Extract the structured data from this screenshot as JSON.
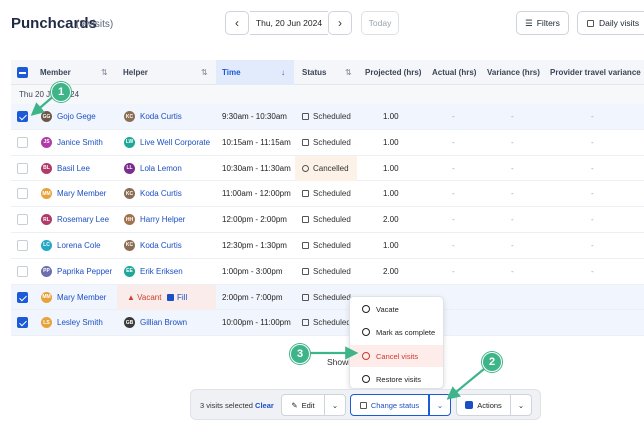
{
  "header": {
    "title": "Punchcards",
    "count": "(9 visits)",
    "date": "Thu, 20 Jun 2024",
    "today": "Today",
    "filters": "Filters",
    "view": "Daily visits"
  },
  "table": {
    "columns": [
      "Member",
      "Helper",
      "Time",
      "Status",
      "Projected (hrs)",
      "Actual (hrs)",
      "Variance (hrs)",
      "Provider travel variance"
    ],
    "group": "Thu 20 Jun 2024",
    "rows": [
      {
        "member": "Gojo Gege",
        "initials": "GG",
        "member_color": "#6b5847",
        "helper": "Koda Curtis",
        "helper_initials": "KC",
        "helper_color": "#8a6d54",
        "time": "9:30am - 10:30am",
        "status": "Scheduled",
        "projected": "1.00",
        "actual": "-",
        "variance": "-",
        "travel": "-",
        "selected": true
      },
      {
        "member": "Janice Smith",
        "initials": "JS",
        "member_color": "#b23aa6",
        "helper": "Live Well Corporate",
        "helper_initials": "LW",
        "helper_color": "#1fa89a",
        "time": "10:15am - 11:15am",
        "status": "Scheduled",
        "projected": "1.00",
        "actual": "-",
        "variance": "-",
        "travel": "-",
        "selected": false
      },
      {
        "member": "Basil Lee",
        "initials": "BL",
        "member_color": "#b23a6a",
        "helper": "Lola Lemon",
        "helper_initials": "LL",
        "helper_color": "#7b2c8c",
        "time": "10:30am - 11:30am",
        "status": "Cancelled",
        "projected": "1.00",
        "actual": "-",
        "variance": "-",
        "travel": "-",
        "selected": false
      },
      {
        "member": "Mary Member",
        "initials": "MM",
        "member_color": "#e8a23c",
        "helper": "Koda Curtis",
        "helper_initials": "KC",
        "helper_color": "#8a6d54",
        "time": "11:00am - 12:00pm",
        "status": "Scheduled",
        "projected": "1.00",
        "actual": "-",
        "variance": "-",
        "travel": "-",
        "selected": false
      },
      {
        "member": "Rosemary Lee",
        "initials": "RL",
        "member_color": "#b23a6a",
        "helper": "Harry Helper",
        "helper_initials": "HH",
        "helper_color": "#a0724e",
        "time": "12:00pm - 2:00pm",
        "status": "Scheduled",
        "projected": "2.00",
        "actual": "-",
        "variance": "-",
        "travel": "-",
        "selected": false
      },
      {
        "member": "Lorena Cole",
        "initials": "LC",
        "member_color": "#24a8c4",
        "helper": "Koda Curtis",
        "helper_initials": "KC",
        "helper_color": "#8a6d54",
        "time": "12:30pm - 1:30pm",
        "status": "Scheduled",
        "projected": "1.00",
        "actual": "-",
        "variance": "-",
        "travel": "-",
        "selected": false
      },
      {
        "member": "Paprika Pepper",
        "initials": "PP",
        "member_color": "#6c6fae",
        "helper": "Erik Eriksen",
        "helper_initials": "EE",
        "helper_color": "#1fa89a",
        "time": "1:00pm - 3:00pm",
        "status": "Scheduled",
        "projected": "2.00",
        "actual": "-",
        "variance": "-",
        "travel": "-",
        "selected": false
      },
      {
        "member": "Mary Member",
        "initials": "MM",
        "member_color": "#e8a23c",
        "helper": "",
        "vacant": "Vacant",
        "fill": "Fill",
        "time": "2:00pm - 7:00pm",
        "status": "Scheduled",
        "projected": "",
        "actual": "",
        "variance": "",
        "travel": "",
        "selected": true
      },
      {
        "member": "Lesley Smith",
        "initials": "LS",
        "member_color": "#e8a23c",
        "helper": "Gillian Brown",
        "helper_initials": "GB",
        "helper_color": "#3a3a3a",
        "time": "10:00pm - 11:00pm",
        "status": "Scheduled",
        "projected": "",
        "actual": "",
        "variance": "",
        "travel": "",
        "selected": true
      }
    ]
  },
  "menu": {
    "items": [
      "Vacate",
      "Mark as complete",
      "Cancel visits",
      "Restore visits"
    ]
  },
  "showing": "Showi",
  "bottombar": {
    "selected": "3 visits selected",
    "clear": "Clear",
    "edit": "Edit",
    "change_status": "Change status",
    "actions": "Actions"
  },
  "annotations": [
    "1",
    "2",
    "3"
  ],
  "colors": {
    "accent": "#1d5ad8",
    "annotation": "#3eb489",
    "danger": "#d0392b"
  }
}
